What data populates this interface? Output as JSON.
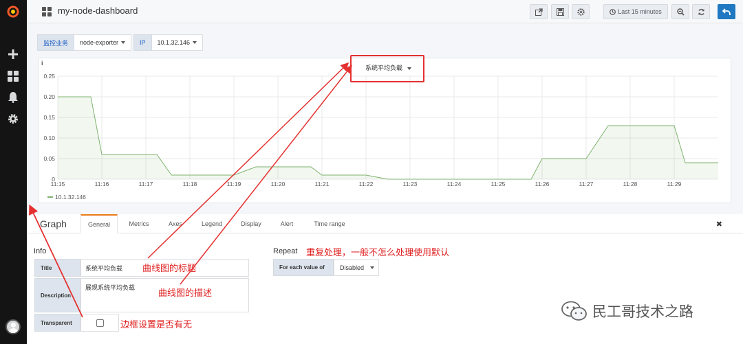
{
  "header": {
    "dashboard_title": "my-node-dashboard",
    "time_range_label": "Last 15 minutes"
  },
  "variables": [
    {
      "label": "监控业务",
      "value": "node-exporter"
    },
    {
      "label": "IP",
      "value": "10.1.32.146"
    }
  ],
  "panel": {
    "info_icon": "i",
    "title": "系统平均负载",
    "legend": "10.1.32.146"
  },
  "chart_data": {
    "type": "area",
    "x": [
      "11:15",
      "11:15:45",
      "11:16",
      "11:17:10",
      "11:17:15",
      "11:17:35",
      "11:19",
      "11:19:30",
      "11:20",
      "11:20:45",
      "11:21",
      "11:22",
      "11:22:30",
      "11:23",
      "11:24",
      "11:25",
      "11:25:45",
      "11:26",
      "11:26:30",
      "11:27",
      "11:27:30",
      "11:28",
      "11:29",
      "11:29:15",
      "11:29:30",
      "11:30"
    ],
    "series": [
      {
        "name": "10.1.32.146",
        "color": "#7eb26d",
        "values": [
          0.2,
          0.2,
          0.06,
          0.06,
          0.06,
          0.01,
          0.01,
          0.03,
          0.03,
          0.03,
          0.01,
          0.01,
          0,
          0,
          0,
          0,
          0,
          0.05,
          0.05,
          0.05,
          0.13,
          0.13,
          0.13,
          0.04,
          0.04,
          0.04
        ]
      }
    ],
    "x_ticks": [
      "11:15",
      "11:16",
      "11:17",
      "11:18",
      "11:19",
      "11:20",
      "11:21",
      "11:22",
      "11:23",
      "11:24",
      "11:25",
      "11:26",
      "11:27",
      "11:28",
      "11:29"
    ],
    "y_ticks": [
      "0",
      "0.05",
      "0.10",
      "0.15",
      "0.20",
      "0.25"
    ],
    "ylim": [
      0,
      0.25
    ],
    "grid": true,
    "legend_position": "bottom-left"
  },
  "editor": {
    "title": "Graph",
    "tabs": [
      "General",
      "Metrics",
      "Axes",
      "Legend",
      "Display",
      "Alert",
      "Time range"
    ],
    "info_section": "Info",
    "fields": {
      "title_label": "Title",
      "title_value": "系统平均负载",
      "description_label": "Description",
      "description_value": "展现系统平均负载",
      "transparent_label": "Transparent"
    },
    "repeat_section": "Repeat",
    "repeat_label": "For each value of",
    "repeat_value": "Disabled"
  },
  "annotations": {
    "title_note": "曲线图的标题",
    "description_note": "曲线图的描述",
    "transparent_note": "边框设置是否有无",
    "repeat_note": "重复处理，一般不怎么处理使用默认"
  },
  "watermark": "民工哥技术之路"
}
